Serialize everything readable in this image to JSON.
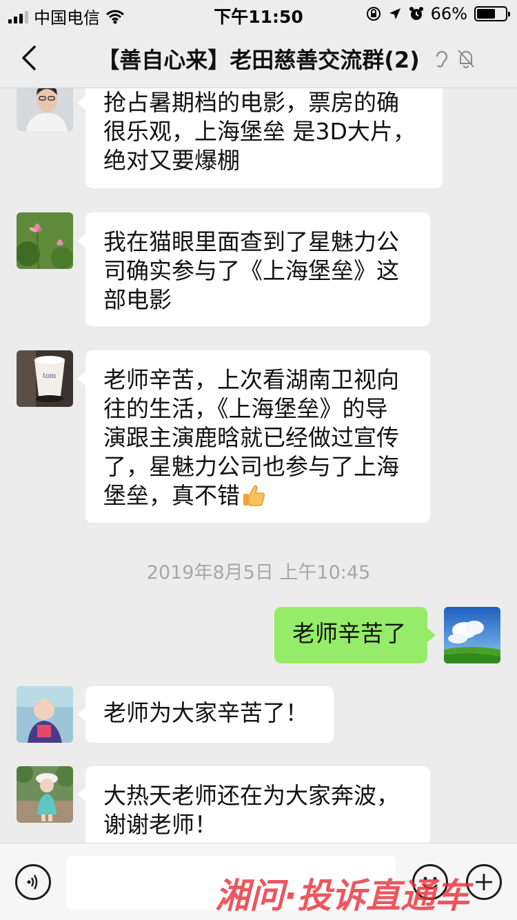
{
  "status_bar": {
    "carrier": "中国电信",
    "time": "下午11:50",
    "battery_percent": "66%",
    "battery_level": 0.66
  },
  "nav": {
    "title": "【善自心来】老田慈善交流群(2)"
  },
  "messages": [
    {
      "side": "left",
      "avatar": "man-portrait-avatar",
      "lines": [
        "抢占暑期档的电影，票房的确",
        "很乐观，上海堡垒 是3D大片，",
        "绝对又要爆棚"
      ]
    },
    {
      "side": "left",
      "avatar": "lotus-flower-avatar",
      "lines": [
        "我在猫眼里面查到了星魅力公",
        "司确实参与了《上海堡垒》这",
        "部电影"
      ]
    },
    {
      "side": "left",
      "avatar": "coffee-cup-avatar",
      "lines": [
        "老师辛苦，上次看湖南卫视向",
        "往的生活，《上海堡垒》的导",
        "演跟主演鹿晗就已经做过宣传",
        "了，星魅力公司也参与了上海",
        "堡垒，真不错"
      ],
      "emoji": "thumbs-up-emoji"
    },
    {
      "side": "right",
      "avatar": "sky-landscape-avatar",
      "lines": [
        "老师辛苦了"
      ]
    },
    {
      "side": "left",
      "avatar": "child-portrait-avatar",
      "lines": [
        "老师为大家辛苦了！"
      ]
    },
    {
      "side": "left",
      "avatar": "child-outdoor-avatar",
      "lines": [
        "大热天老师还在为大家奔波，",
        "谢谢老师！"
      ]
    }
  ],
  "timestamp": "2019年8月5日 上午10:45",
  "input_bar": {
    "placeholder": "",
    "voice_icon": "voice-icon",
    "emoji_icon": "emoji-icon",
    "plus_icon": "plus-icon"
  },
  "watermark": {
    "text": "湘问·投诉直通车",
    "color": "#e8323c"
  },
  "colors": {
    "background": "#ececec",
    "bubble_other": "#ffffff",
    "bubble_self": "#95ec69"
  }
}
